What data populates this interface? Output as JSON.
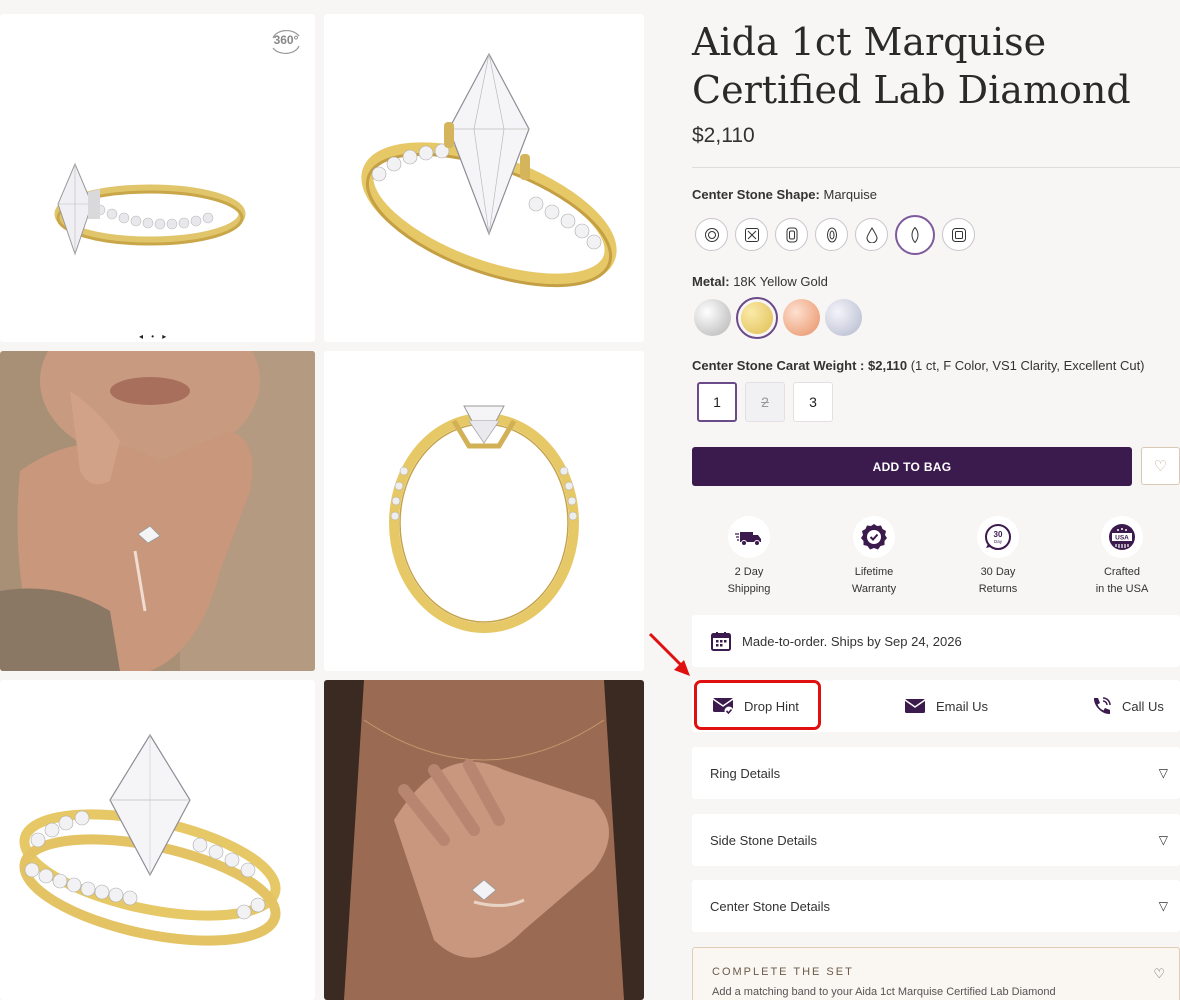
{
  "gallery": {
    "badge_360": "360°",
    "slider_dots": "◂ • ▸"
  },
  "product": {
    "title": "Aida 1ct Marquise Certified Lab Diamond",
    "price": "$2,110"
  },
  "shape_option": {
    "label": "Center Stone Shape:",
    "value": "Marquise",
    "shapes": [
      "round",
      "asscher",
      "cushion",
      "oval",
      "pear",
      "marquise",
      "radiant"
    ],
    "selected": "marquise"
  },
  "metal_option": {
    "label": "Metal:",
    "value": "18K Yellow Gold",
    "swatches": [
      {
        "name": "white-gold",
        "color": "#d9d9d9"
      },
      {
        "name": "yellow-gold",
        "color": "#e8cc6e"
      },
      {
        "name": "rose-gold",
        "color": "#f1b08f"
      },
      {
        "name": "platinum",
        "color": "#cdd0de"
      }
    ],
    "selected": "yellow-gold"
  },
  "carat_option": {
    "label": "Center Stone Carat Weight :",
    "price": "$2,110",
    "detail": "(1 ct, F Color, VS1 Clarity, Excellent Cut)",
    "values": [
      "1",
      "2",
      "3"
    ],
    "selected": "1",
    "disabled": "2"
  },
  "actions": {
    "add_to_bag": "ADD TO BAG",
    "wishlist_icon": "♡"
  },
  "perks": [
    {
      "icon": "truck-icon",
      "line1": "2 Day",
      "line2": "Shipping"
    },
    {
      "icon": "warranty-badge-icon",
      "line1": "Lifetime",
      "line2": "Warranty"
    },
    {
      "icon": "30-day-returns-icon",
      "line1": "30 Day",
      "line2": "Returns"
    },
    {
      "icon": "usa-badge-icon",
      "line1": "Crafted",
      "line2": "in the USA"
    }
  ],
  "ship_notice": "Made-to-order. Ships by Sep 24, 2026",
  "contact": {
    "drop_hint": "Drop Hint",
    "email_us": "Email Us",
    "call_us": "Call Us"
  },
  "accordions": {
    "ring_details": "Ring Details",
    "side_stone_details": "Side Stone Details",
    "center_stone_details": "Center Stone Details"
  },
  "complete_set": {
    "title": "COMPLETE THE SET",
    "desc": "Add a matching band to your Aida 1ct Marquise Certified Lab Diamond"
  },
  "colors": {
    "brand": "#3b1a4e",
    "accent": "#6b4a8a",
    "annotation": "#e01010"
  }
}
